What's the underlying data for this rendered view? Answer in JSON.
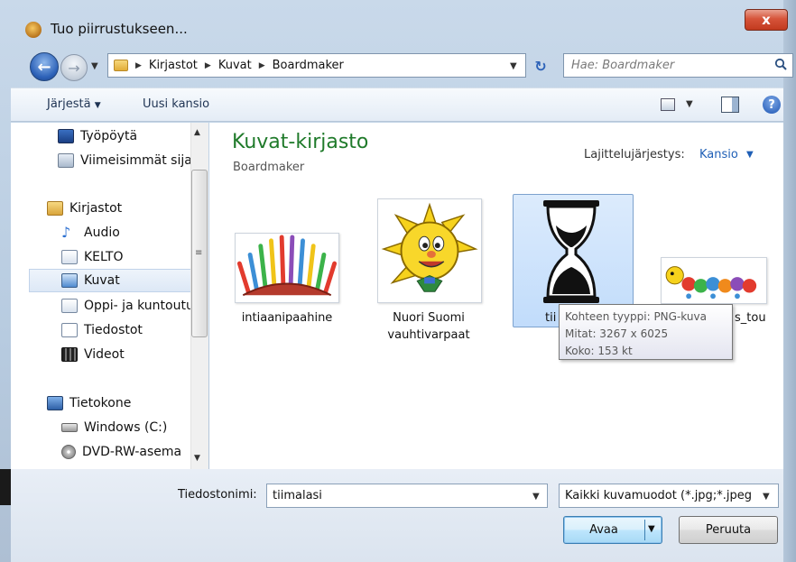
{
  "window": {
    "title": "Tuo piirrustukseen...",
    "close_label": "x"
  },
  "navigation": {
    "breadcrumbs": [
      "Kirjastot",
      "Kuvat",
      "Boardmaker"
    ],
    "search_placeholder": "Hae: Boardmaker"
  },
  "toolbar": {
    "organize_label": "Järjestä",
    "new_folder_label": "Uusi kansio"
  },
  "sidebar": {
    "items": [
      {
        "label": "Työpöytä",
        "icon": "desktop-icon"
      },
      {
        "label": "Viimeisimmät sijainnit",
        "icon": "recent-places-icon"
      },
      {
        "label": "Kirjastot",
        "icon": "libraries-icon"
      },
      {
        "label": "Audio",
        "icon": "music-icon"
      },
      {
        "label": "KELTO",
        "icon": "document-library-icon"
      },
      {
        "label": "Kuvat",
        "icon": "pictures-icon",
        "selected": true
      },
      {
        "label": "Oppi- ja kuntoutuspalvelu",
        "icon": "document-library-icon"
      },
      {
        "label": "Tiedostot",
        "icon": "documents-icon"
      },
      {
        "label": "Videot",
        "icon": "videos-icon"
      },
      {
        "label": "Tietokone",
        "icon": "computer-icon"
      },
      {
        "label": "Windows (C:)",
        "icon": "drive-icon"
      },
      {
        "label": "DVD-RW-asema",
        "icon": "dvd-icon"
      }
    ]
  },
  "library": {
    "title": "Kuvat-kirjasto",
    "subtitle": "Boardmaker",
    "sort_label": "Lajittelujärjestys:",
    "sort_value": "Kansio"
  },
  "files": [
    {
      "name": "intiaanipaahine",
      "icon": "feather-headdress-image"
    },
    {
      "name": "Nuori Suomi vauhtivarpaat",
      "icon": "sun-mascot-image"
    },
    {
      "name": "tii",
      "icon": "hourglass-image",
      "selected": true
    },
    {
      "name": "s_tou",
      "icon": "caterpillar-image"
    }
  ],
  "tooltip": {
    "line1": "Kohteen tyyppi: PNG-kuva",
    "line2": "Mitat: 3267 x 6025",
    "line3": "Koko: 153 kt"
  },
  "footer": {
    "filename_label": "Tiedostonimi:",
    "filename_value": "tiimalasi",
    "filetype_value": "Kaikki kuvamuodot (*.jpg;*.jpeg",
    "open_label": "Avaa",
    "cancel_label": "Peruuta"
  }
}
